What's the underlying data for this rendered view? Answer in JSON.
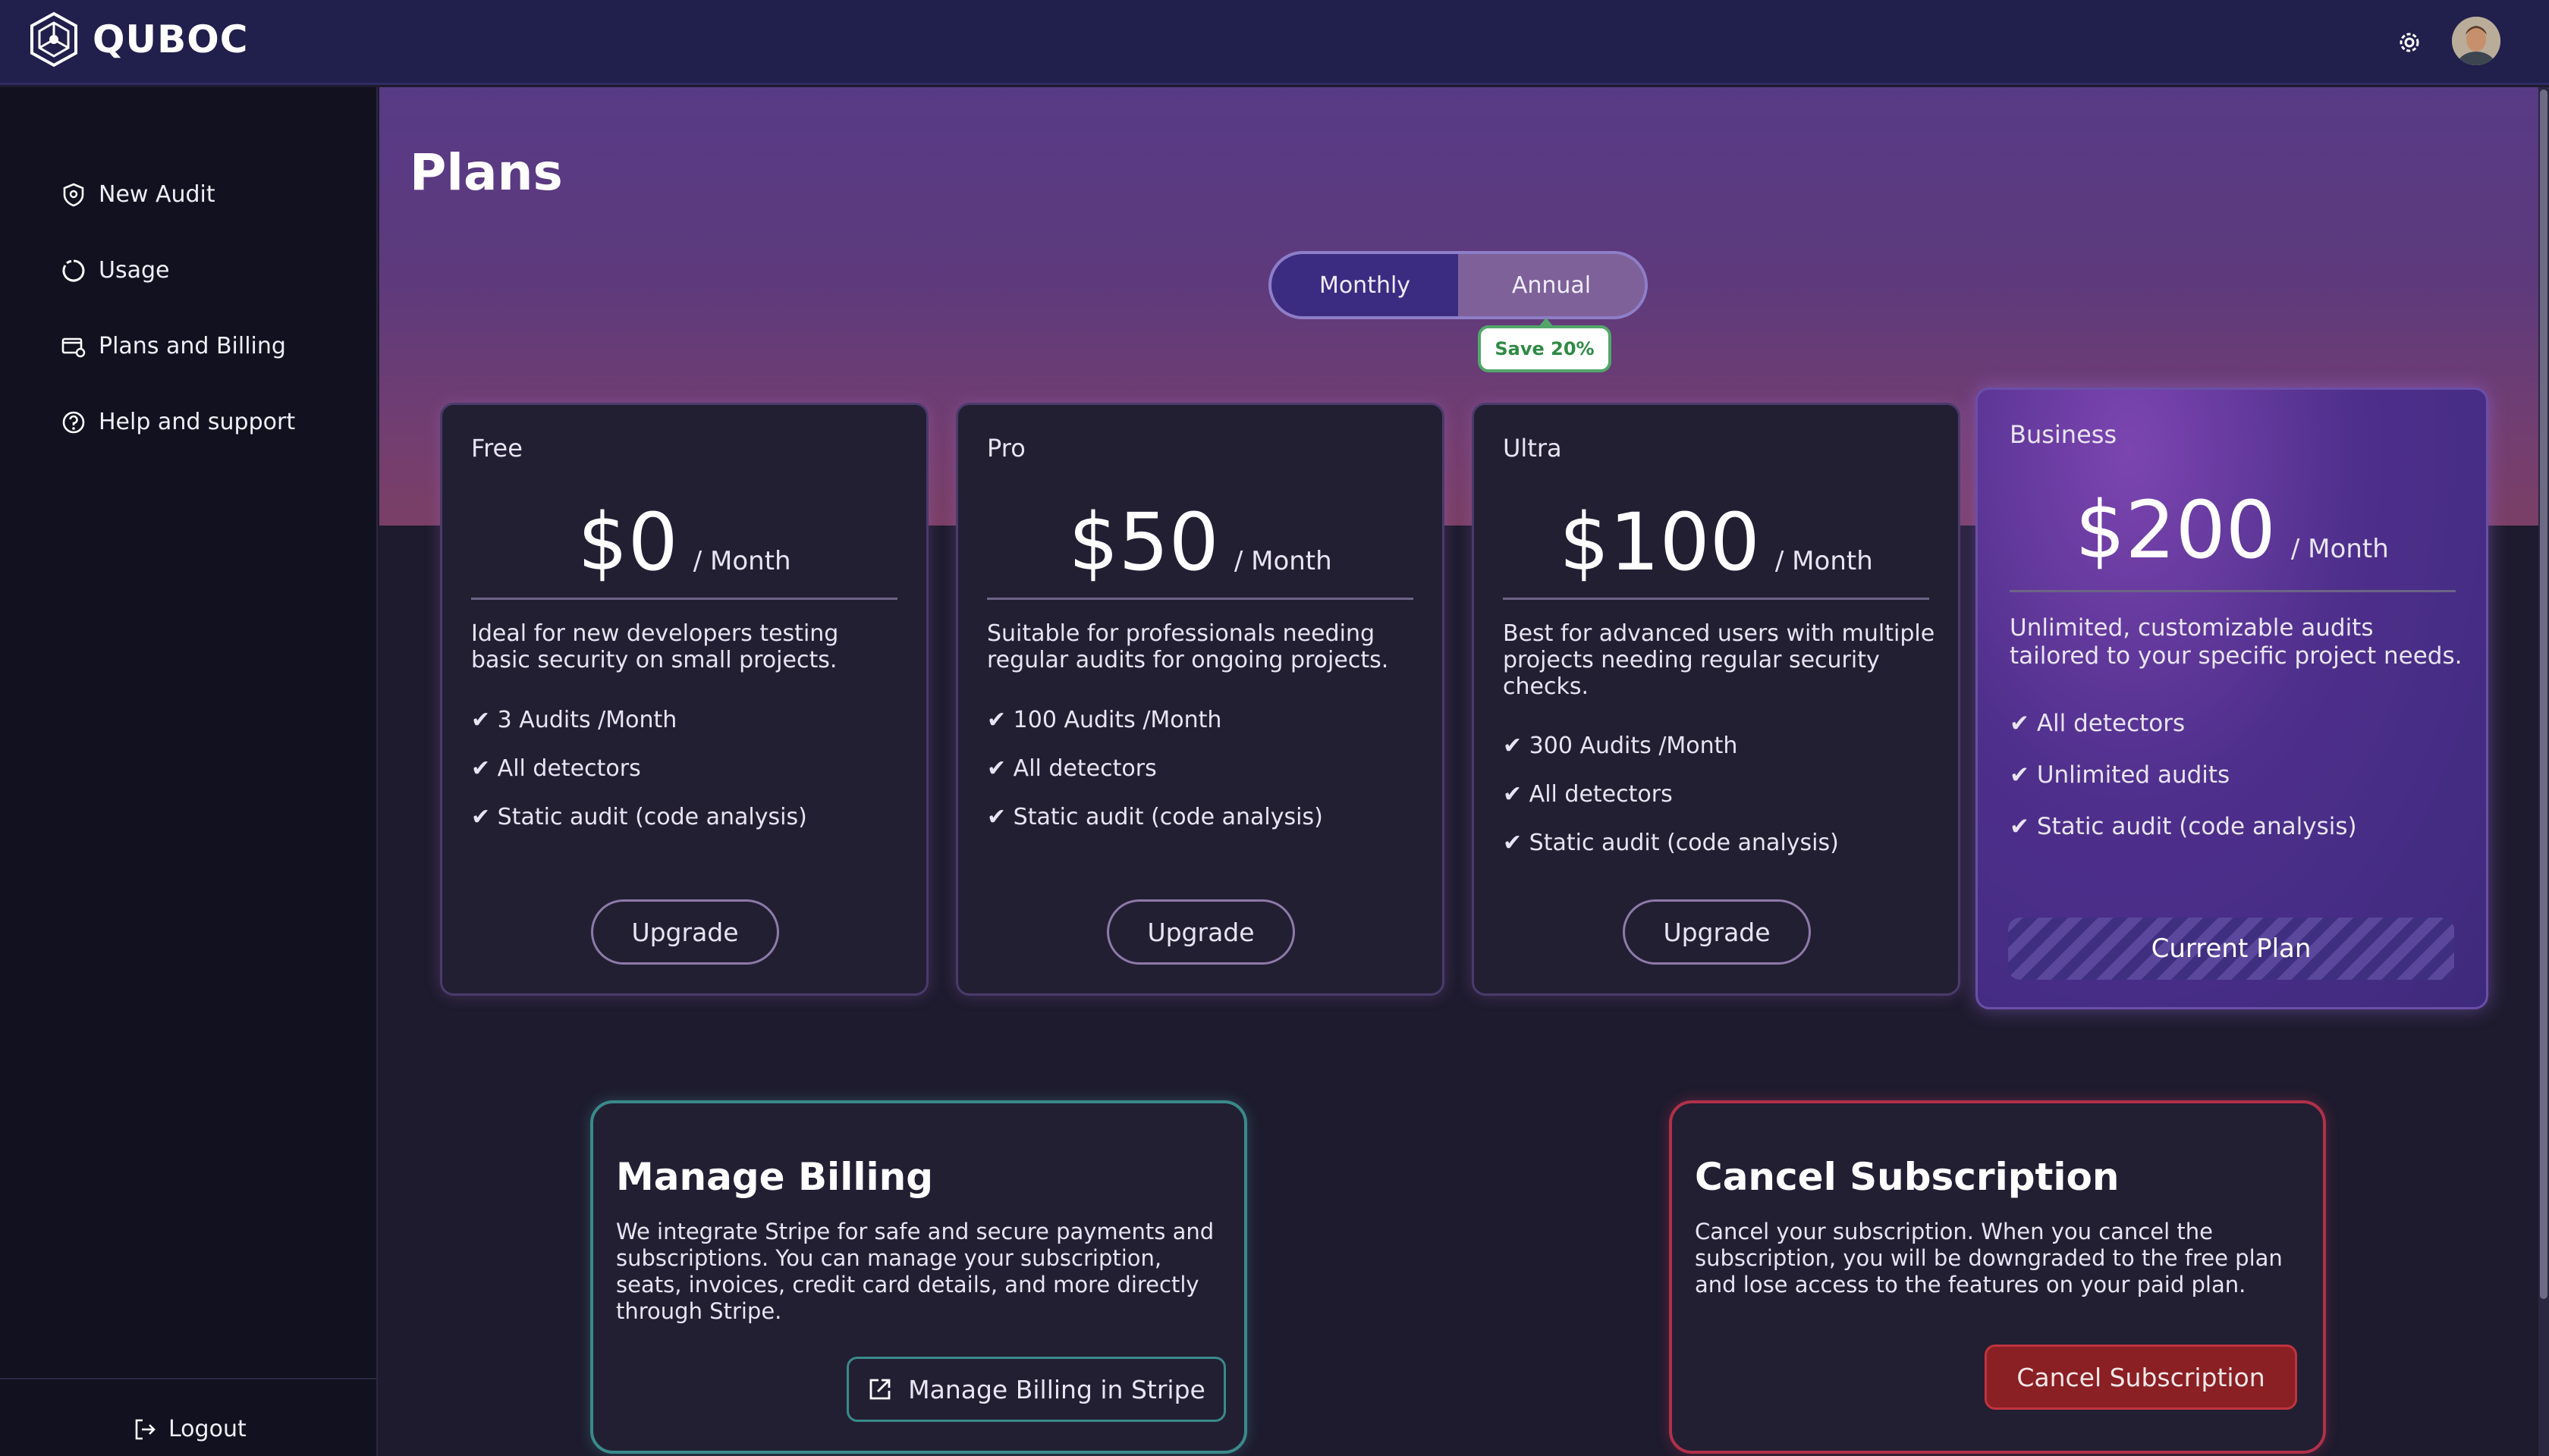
{
  "app": {
    "name": "QUBOC"
  },
  "sidebar": {
    "items": [
      {
        "label": "New Audit",
        "icon": "shield-icon"
      },
      {
        "label": "Usage",
        "icon": "usage-circle-icon"
      },
      {
        "label": "Plans and Billing",
        "icon": "billing-card-icon"
      },
      {
        "label": "Help and support",
        "icon": "help-circle-icon"
      }
    ],
    "logout": "Logout"
  },
  "page": {
    "title": "Plans"
  },
  "billing_toggle": {
    "monthly": "Monthly",
    "annual": "Annual",
    "selected": "Monthly",
    "badge": "Save 20%"
  },
  "plans": [
    {
      "name": "Free",
      "price": "$0",
      "period": "/ Month",
      "description": "Ideal for new developers testing basic security on small projects.",
      "features": [
        "✔ 3 Audits /Month",
        "✔ All detectors",
        "✔ Static audit (code analysis)"
      ],
      "action": "Upgrade"
    },
    {
      "name": "Pro",
      "price": "$50",
      "period": "/ Month",
      "description": "Suitable for professionals needing regular audits for ongoing projects.",
      "features": [
        "✔ 100 Audits /Month",
        "✔ All detectors",
        "✔ Static audit (code analysis)"
      ],
      "action": "Upgrade"
    },
    {
      "name": "Ultra",
      "price": "$100",
      "period": "/ Month",
      "description": "Best for advanced users with multiple projects needing regular security checks.",
      "features": [
        "✔ 300 Audits /Month",
        "✔ All detectors",
        "✔ Static audit (code analysis)"
      ],
      "action": "Upgrade"
    },
    {
      "name": "Business",
      "price": "$200",
      "period": "/ Month",
      "description": "Unlimited, customizable audits tailored to your specific project needs.",
      "features": [
        "✔ All detectors",
        "✔ Unlimited audits",
        "✔ Static audit (code analysis)"
      ],
      "action": "Current Plan"
    }
  ],
  "manage_billing": {
    "title": "Manage Billing",
    "text": "We integrate Stripe for safe and secure payments and subscriptions. You can manage your subscription, seats, invoices, credit card details, and more directly through Stripe.",
    "button": "Manage Billing in Stripe"
  },
  "cancel_subscription": {
    "title": "Cancel Subscription",
    "text": "Cancel your subscription. When you cancel the subscription, you will be downgraded to the free plan and lose access to the features on your paid plan.",
    "button": "Cancel Subscription"
  },
  "colors": {
    "topbar": "#211f4c",
    "sidebar": "#12111f",
    "card": "#221f33",
    "accent_purple": "#3b2c82",
    "badge_green": "#2f8a45",
    "billing_teal": "#3a8a8a",
    "cancel_red": "#8a1f24"
  }
}
